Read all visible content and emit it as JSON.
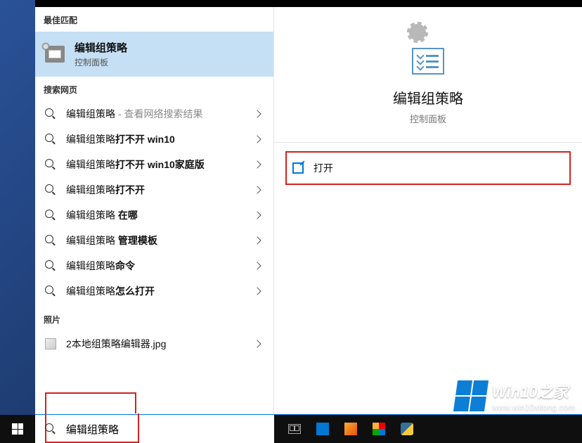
{
  "sections": {
    "best_match": "最佳匹配",
    "web": "搜索网页",
    "photos": "照片"
  },
  "best_match": {
    "title": "编辑组策略",
    "subtitle": "控制面板"
  },
  "web_results": [
    {
      "prefix": "编辑组策略",
      "suffix": "",
      "extra": " - 查看网络搜索结果"
    },
    {
      "prefix": "编辑组策略",
      "suffix": "打不开 win10",
      "extra": ""
    },
    {
      "prefix": "编辑组策略",
      "suffix": "打不开 win10家庭版",
      "extra": ""
    },
    {
      "prefix": "编辑组策略",
      "suffix": "打不开",
      "extra": ""
    },
    {
      "prefix": "编辑组策略",
      "suffix": " 在哪",
      "extra": ""
    },
    {
      "prefix": "编辑组策略",
      "suffix": " 管理模板",
      "extra": ""
    },
    {
      "prefix": "编辑组策略",
      "suffix": "命令",
      "extra": ""
    },
    {
      "prefix": "编辑组策略",
      "suffix": "怎么打开",
      "extra": ""
    }
  ],
  "photos": [
    {
      "name": "2本地组策略编辑器.jpg"
    }
  ],
  "details": {
    "title": "编辑组策略",
    "subtitle": "控制面板",
    "actions": {
      "open": "打开"
    }
  },
  "search": {
    "value": "编辑组策略"
  },
  "watermark": {
    "title": "Win10之家",
    "url": "www.win10xitong.com"
  }
}
